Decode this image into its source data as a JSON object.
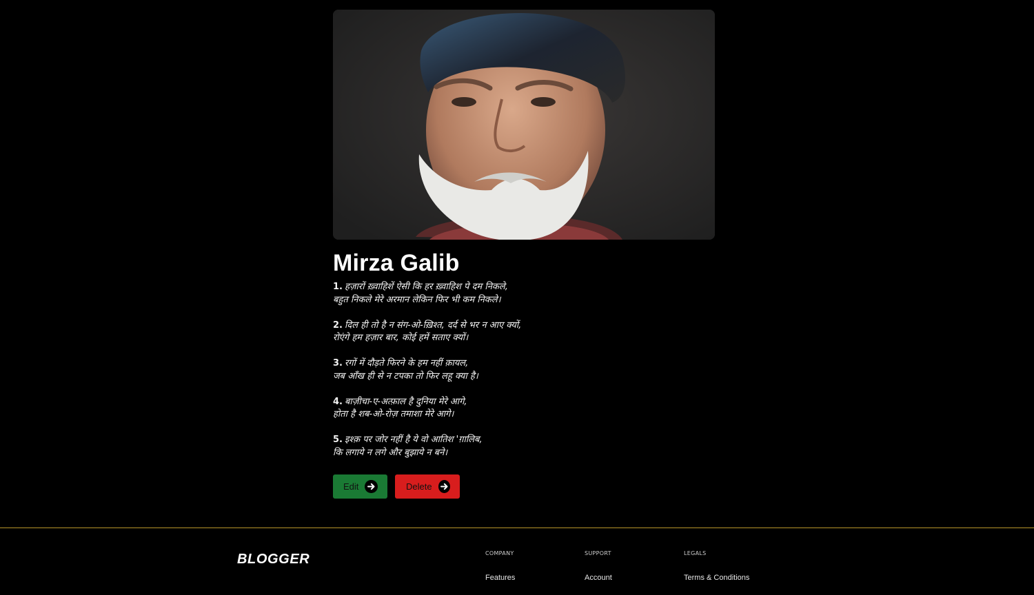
{
  "article": {
    "portrait_alt": "Mirza Galib",
    "title": "Mirza Galib",
    "poems": [
      {
        "number": "1.",
        "line1": "हज़ारों ख़्वाहिशें ऐसी कि हर ख़्वाहिश पे दम निकले,",
        "line2": "बहुत निकले मेरे अरमान लेकिन फिर भी कम निकले।"
      },
      {
        "number": "2.",
        "line1": "दिल ही तो है न संग-ओ-ख़िश्त, दर्द से भर न आए क्यों,",
        "line2": "रोएंगे हम हज़ार बार, कोई हमें सताए क्यों।"
      },
      {
        "number": "3.",
        "line1": "रगों में दौड़ते फिरने के हम नहीं क़ायल,",
        "line2": "जब आँख ही से न टपका तो फिर लहू क्या है।"
      },
      {
        "number": "4.",
        "line1": "बाज़ीचा-ए-अत्फ़ाल है दुनिया मेरे आगे,",
        "line2": "होता है शब-ओ-रोज़ तमाशा मेरे आगे।"
      },
      {
        "number": "5.",
        "line1": "इश्क़ पर जोर नहीं है ये वो आतिश 'ग़ालिब,",
        "line2": "कि लगाये न लगे और बुझाये न बने।"
      }
    ]
  },
  "actions": {
    "edit_label": "Edit",
    "delete_label": "Delete",
    "edit_color": "#1a7a34",
    "delete_color": "#d81d1d",
    "arrow_icon": "arrow-right-circle-icon"
  },
  "footer": {
    "brand": "BLOGGER",
    "accent_color": "#b8952a",
    "columns": [
      {
        "heading": "COMPANY",
        "link": "Features"
      },
      {
        "heading": "SUPPORT",
        "link": "Account"
      },
      {
        "heading": "LEGALS",
        "link": "Terms & Conditions"
      }
    ]
  }
}
